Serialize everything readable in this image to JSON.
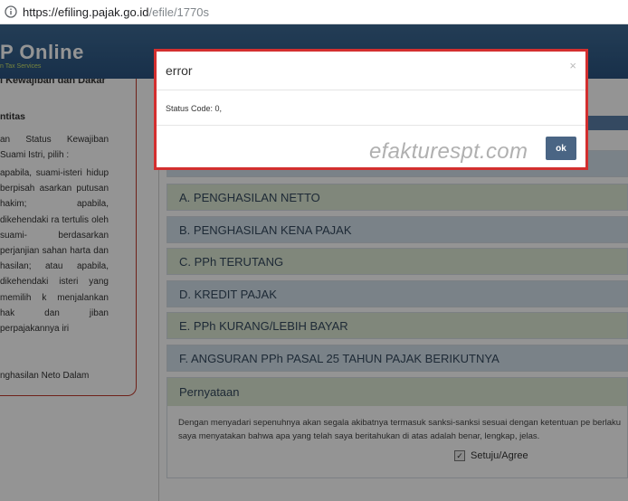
{
  "browser": {
    "url_host": "https://efiling.pajak.go.id",
    "url_path": "/efile/1770s"
  },
  "header": {
    "brand": "P Online",
    "brand_sub": "n Tax Services"
  },
  "left_panel": {
    "title_cut": "i Kewajiban dan Dakar",
    "heading": "ntitas",
    "para1": "an Status Kewajiban Suami Istri, pilih :",
    "para2": "apabila, suami-isteri hidup berpisah asarkan putusan hakim; apabila, dikehendaki ra tertulis oleh suami- berdasarkan perjanjian sahan harta dan hasilan; atau apabila, dikehendaki isteri yang memilih k menjalankan hak dan jiban perpajakannya iri",
    "para3": "nghasilan Neto Dalam"
  },
  "sections": [
    {
      "label": "A. PENGHASILAN NETTO",
      "color": "green"
    },
    {
      "label": "B. PENGHASILAN KENA PAJAK",
      "color": "blue"
    },
    {
      "label": "C. PPh TERUTANG",
      "color": "green"
    },
    {
      "label": "D. KREDIT PAJAK",
      "color": "blue"
    },
    {
      "label": "E. PPh KURANG/LEBIH BAYAR",
      "color": "green"
    },
    {
      "label": "F. ANGSURAN PPh PASAL 25 TAHUN PAJAK BERIKUTNYA",
      "color": "blue"
    }
  ],
  "pernyataan": {
    "heading": "Pernyataan",
    "text": "Dengan menyadari sepenuhnya akan segala akibatnya termasuk sanksi-sanksi sesuai dengan ketentuan pe berlaku saya menyatakan bahwa apa yang telah saya beritahukan di atas adalah benar, lengkap, jelas.",
    "agree_label": "Setuju/Agree",
    "agree_checked": true
  },
  "dialog": {
    "title": "error",
    "close_glyph": "×",
    "message": "Status Code: 0,",
    "watermark": "efakturespt.com",
    "ok_label": "ok",
    "border_color": "#d32f2f"
  }
}
